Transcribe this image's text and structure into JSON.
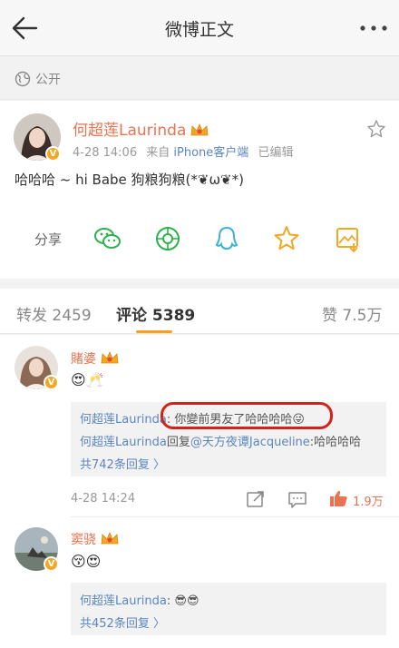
{
  "navbar": {
    "title": "微博正文"
  },
  "visibility": {
    "label": "公开"
  },
  "post": {
    "author": "何超莲Laurinda",
    "date": "4-28 14:06",
    "source_prefix": "来自",
    "source": "iPhone客户端",
    "edited": "已编辑",
    "text": "哈哈哈 ~ hi Babe 狗粮狗粮(*❦ω❦*)",
    "share_label": "分享"
  },
  "tabs": [
    {
      "label": "转发",
      "count": "2459"
    },
    {
      "label": "评论",
      "count": "5389"
    },
    {
      "label": "赞",
      "count": "7.5万"
    }
  ],
  "comments": [
    {
      "name": "賭婆",
      "emoji": "😍🥂",
      "replies": [
        {
          "name": "何超莲Laurinda",
          "text": ": 你變前男友了哈哈哈哈😜"
        },
        {
          "name": "何超莲Laurinda",
          "text_mid": "回复",
          "mention": "@天方夜谭Jacqueline",
          "text": ":哈哈哈哈"
        }
      ],
      "more": "共742条回复 〉",
      "time": "4-28 14:24",
      "likes": "1.9万"
    },
    {
      "name": "窦骁",
      "emoji": "😚😍",
      "replies": [
        {
          "name": "何超莲Laurinda",
          "text": ": 😎😎"
        }
      ],
      "more": "共452条回复 〉"
    }
  ],
  "colors": {
    "accent": "#f7a01e",
    "name": "#eb7350",
    "link": "#5b86c0",
    "highlight": "#d0241b"
  }
}
